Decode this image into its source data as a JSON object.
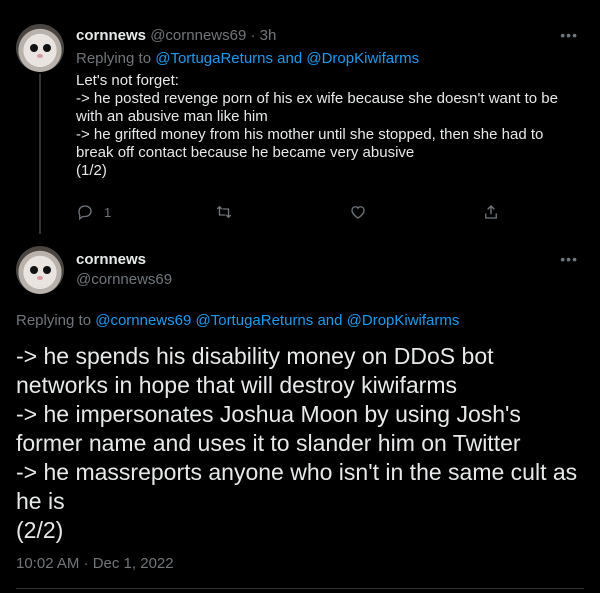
{
  "tweet1": {
    "display_name": "cornnews",
    "meta": "@cornnews69 · 3h",
    "replying_prefix": "Replying to",
    "mentions": "@TortugaReturns and @DropKiwifarms",
    "lines": [
      "Let's not forget:",
      "-> he posted revenge porn of his ex wife because she doesn't want to be with an abusive man like him",
      "-> he grifted money from his mother until she stopped, then she had to break off contact because he became very abusive",
      "(1/2)"
    ],
    "reply_count": "1",
    "more_icon": "ellipsis-icon"
  },
  "tweet2": {
    "display_name": "cornnews",
    "handle": "@cornnews69",
    "replying_prefix": "Replying to",
    "mentions": "@cornnews69 @TortugaReturns and @DropKiwifarms",
    "lines": [
      "-> he spends his disability money on DDoS bot networks in hope that will destroy kiwifarms",
      "-> he impersonates Joshua Moon by using Josh's former name and uses it to slander him on Twitter",
      "-> he massreports anyone who isn't in the same cult as he is",
      "(2/2)"
    ],
    "timestamp": "10:02 AM · Dec 1, 2022",
    "more_icon": "ellipsis-icon"
  },
  "colors": {
    "background": "#000000",
    "text": "#e7e9ea",
    "muted": "#71767b",
    "link": "#1d9bf0"
  }
}
